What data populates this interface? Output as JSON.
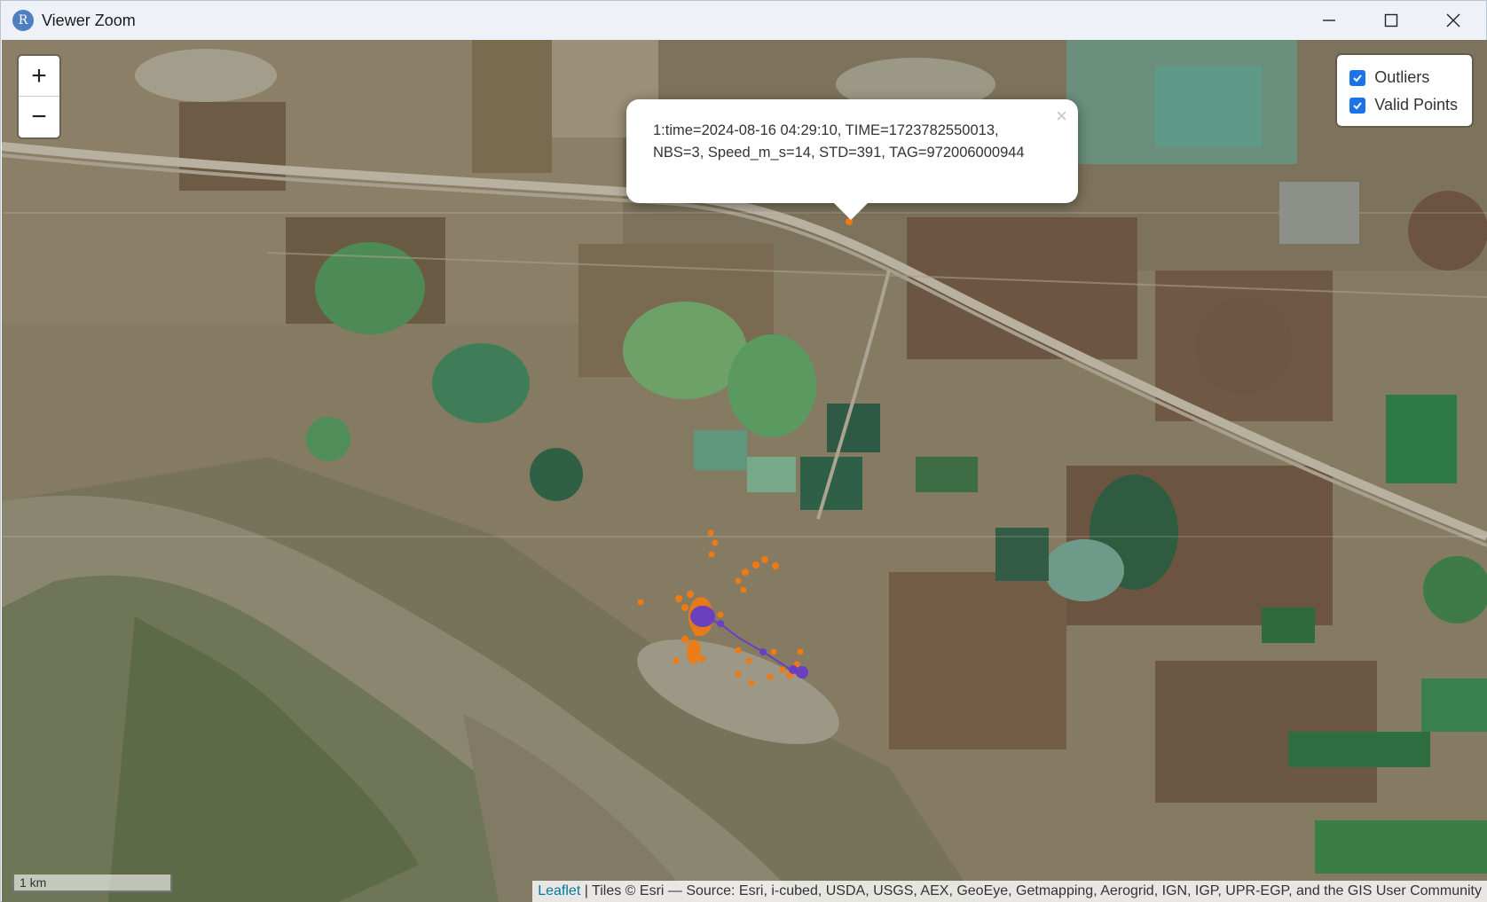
{
  "window": {
    "app_icon_letter": "R",
    "title": "Viewer Zoom"
  },
  "map": {
    "zoom_in_label": "+",
    "zoom_out_label": "−",
    "layers": [
      {
        "label": "Outliers",
        "checked": true
      },
      {
        "label": "Valid Points",
        "checked": true
      }
    ],
    "popup": {
      "text": "1:time=2024-08-16 04:29:10, TIME=1723782550013, NBS=3, Speed_m_s=14, STD=391, TAG=972006000944",
      "close_label": "×"
    },
    "scale_label": "1 km",
    "attribution_link": "Leaflet",
    "attribution_text": " | Tiles © Esri — Source: Esri, i-cubed, USDA, USGS, AEX, GeoEye, Getmapping, Aerogrid, IGN, IGP, UPR-EGP, and the GIS User Community",
    "colors": {
      "outliers": "#f07a12",
      "valid_points": "#6a3fc0"
    }
  }
}
